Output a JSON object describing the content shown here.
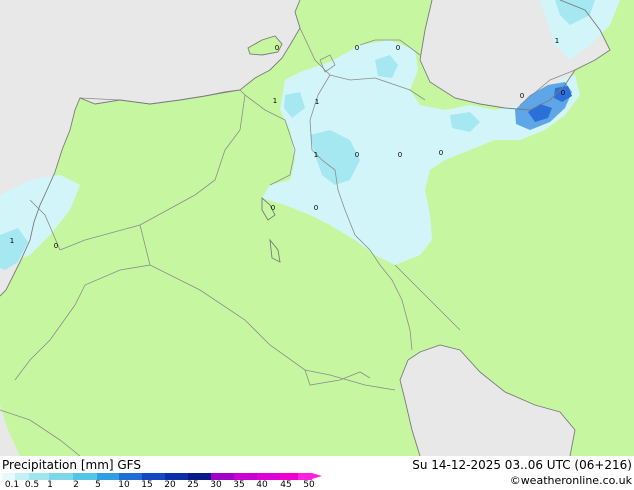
{
  "map": {
    "colors": {
      "land": "#c6f7a0",
      "sea": "#e8e8e8",
      "border": "#8c8c8c",
      "coast": "#7a7a7a",
      "precip_light": "#d2f5fa",
      "precip_mid": "#a6e8f2",
      "precip_strong": "#5fa6e8",
      "precip_heavy": "#2a70d8"
    },
    "values": [
      "0",
      "0",
      "0",
      "1",
      "1",
      "1",
      "0",
      "0",
      "0",
      "0",
      "0",
      "1",
      "0",
      "0",
      "1",
      "0"
    ]
  },
  "footer": {
    "title": "Precipitation [mm] GFS",
    "datetime": "Su 14-12-2025 03..06 UTC (06+216)",
    "credit": "©weatheronline.co.uk"
  },
  "legend": {
    "labels": [
      "0.1",
      "0.5",
      "1",
      "2",
      "5",
      "10",
      "15",
      "20",
      "25",
      "30",
      "35",
      "40",
      "45",
      "50"
    ],
    "colors": [
      "#e6fafc",
      "#c2f0f6",
      "#a0e6f0",
      "#7ad8ea",
      "#52c6e4",
      "#2e9ee0",
      "#1e6ed6",
      "#1448c0",
      "#0c2ea8",
      "#0a1a88",
      "#a000c8",
      "#c800d2",
      "#e000d8",
      "#f000d0",
      "#ff20e0"
    ]
  }
}
